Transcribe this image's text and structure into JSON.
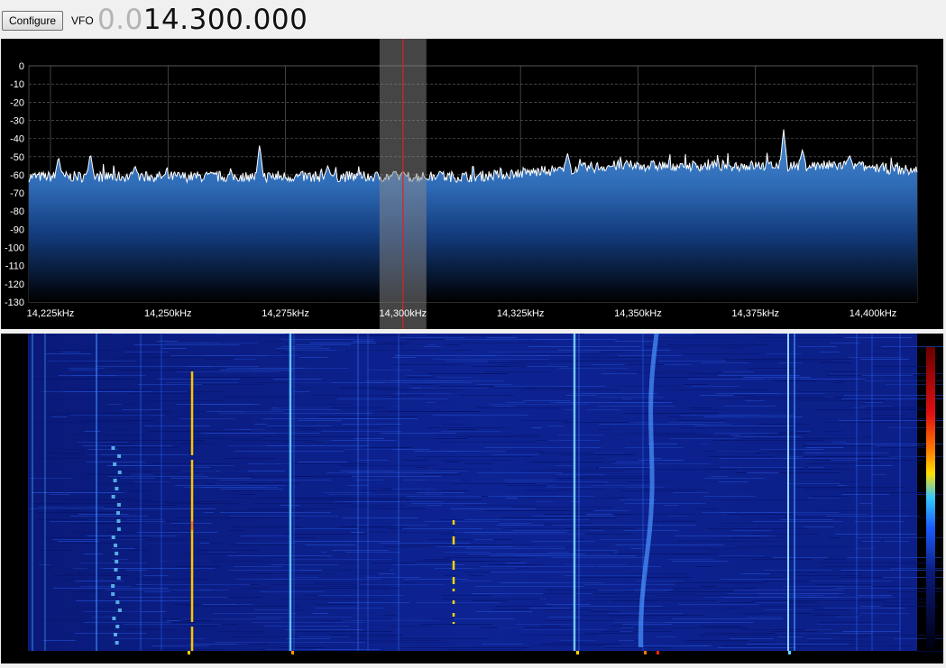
{
  "toolbar": {
    "configure_label": "Configure",
    "vfo_label": "VFO",
    "frequency_dim": "0.0",
    "frequency_main_a": "14.",
    "frequency_highlight_digit": "3",
    "frequency_main_b": "00.000"
  },
  "spectrum": {
    "db_labels": [
      "0",
      "-10",
      "-20",
      "-30",
      "-40",
      "-50",
      "-60",
      "-70",
      "-80",
      "-90",
      "-100",
      "-110",
      "-120",
      "-130"
    ],
    "freq_labels": [
      "14,225kHz",
      "14,250kHz",
      "14,275kHz",
      "14,300kHz",
      "14,325kHz",
      "14,350kHz",
      "14,375kHz",
      "14,400kHz"
    ],
    "tuned_frequency_khz": 14300,
    "filter_bandwidth_khz": 10,
    "colors": {
      "fill_top": "#4a8ad0",
      "fill_bottom": "#000000",
      "trace": "#ffffff",
      "cursor": "#e02020",
      "filter_band": "#8a8a8a"
    }
  },
  "waterfall": {
    "colors": {
      "background": "#0b1f8c",
      "signal": "#2a6cff",
      "strong": "#ffd400",
      "hot": "#ff7a00"
    }
  }
}
